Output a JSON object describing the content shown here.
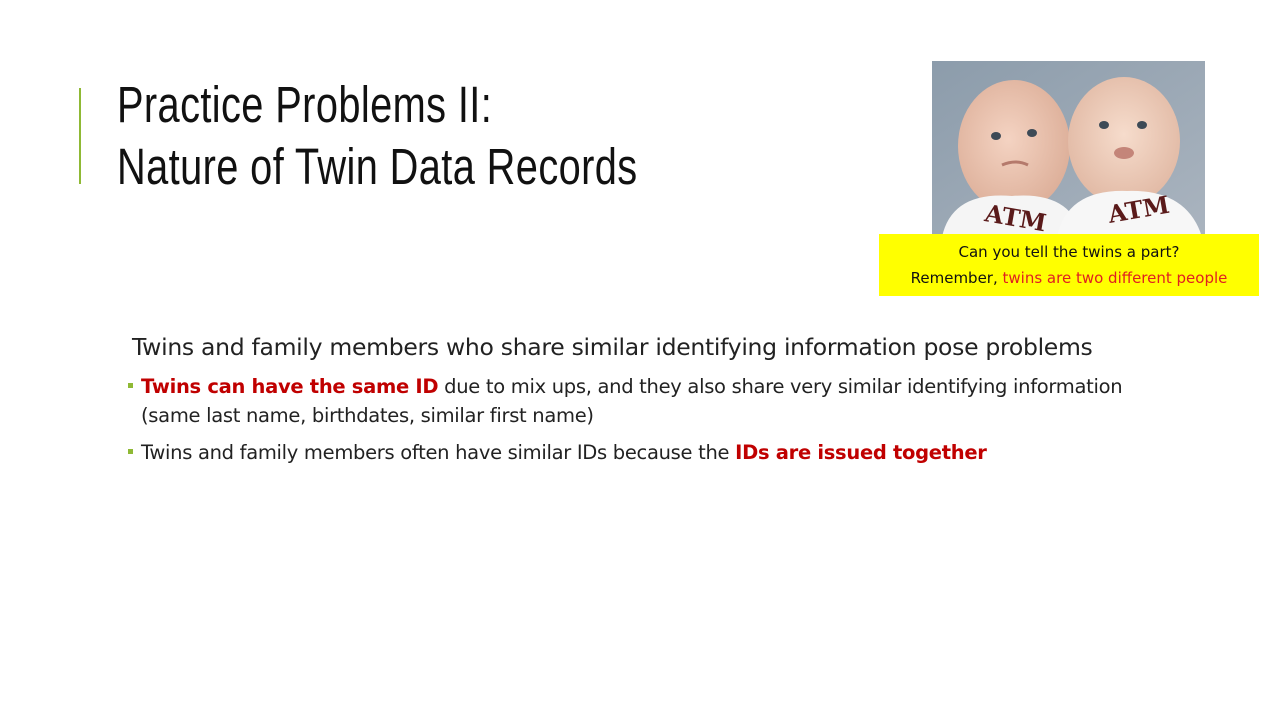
{
  "slide": {
    "title_line1": "Practice Problems II:",
    "title_line2": "Nature of Twin Data Records",
    "accent_color": "#8fb935"
  },
  "photo": {
    "caption_line1": "Can you tell the twins a part?",
    "caption_line2_prefix": "Remember, ",
    "caption_line2_highlight": "twins are two different people",
    "caption_background": "#ffff00",
    "shirt_logo_text": "ATM"
  },
  "content": {
    "lead": "Twins and family members who share similar identifying information pose problems",
    "bullets": [
      {
        "emphasis": "Twins can have the same ID",
        "text": " due to mix ups, and they also share very similar identifying information (same last name, birthdates, similar first name)"
      },
      {
        "text": "Twins and family members often have similar IDs because the ",
        "emphasis": "IDs are issued together"
      }
    ],
    "emphasis_color": "#c00000"
  }
}
